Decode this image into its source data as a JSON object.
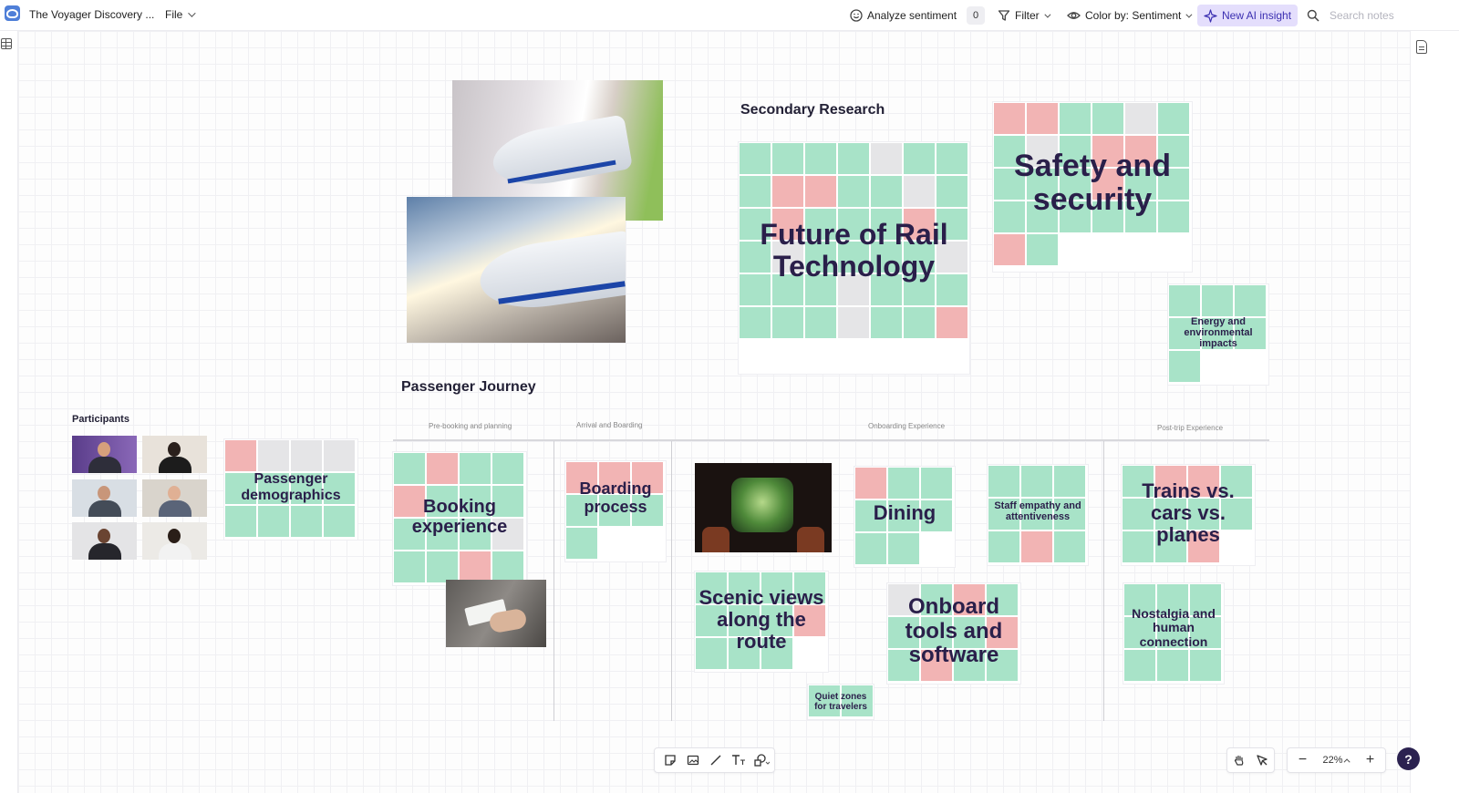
{
  "topbar": {
    "app_title": "The Voyager Discovery ...",
    "file_menu": "File",
    "analyze_label": "Analyze sentiment",
    "analyze_count": "0",
    "filter_label": "Filter",
    "color_by_label": "Color by: Sentiment",
    "new_ai_label": "New AI insight",
    "search_placeholder": "Search notes"
  },
  "colors": {
    "positive": "#a8e3c8",
    "negative": "#f2b4b4",
    "neutral": "#e5e5e7",
    "accent": "#e4defc",
    "text": "#2a1f4a"
  },
  "sections": {
    "secondary_research": "Secondary Research",
    "passenger_journey": "Passenger Journey",
    "participants": "Participants"
  },
  "journey_stages": [
    "Pre-booking and planning",
    "Arrival and Boarding",
    "Onboarding Experience",
    "Post-trip Experience"
  ],
  "clusters": {
    "future": "Future of Rail Technology",
    "safety": "Safety and security",
    "energy": "Energy and environmental impacts",
    "demographics": "Passenger demographics",
    "booking": "Booking experience",
    "boarding": "Boarding process",
    "dining": "Dining",
    "staff": "Staff empathy and attentiveness",
    "trains": "Trains vs. cars vs. planes",
    "scenic": "Scenic views along the route",
    "onboard_tools": "Onboard tools and software",
    "quiet": "Quiet zones for travelers",
    "nostalgia": "Nostalgia and human connection"
  },
  "zoom": {
    "level": "22%"
  }
}
